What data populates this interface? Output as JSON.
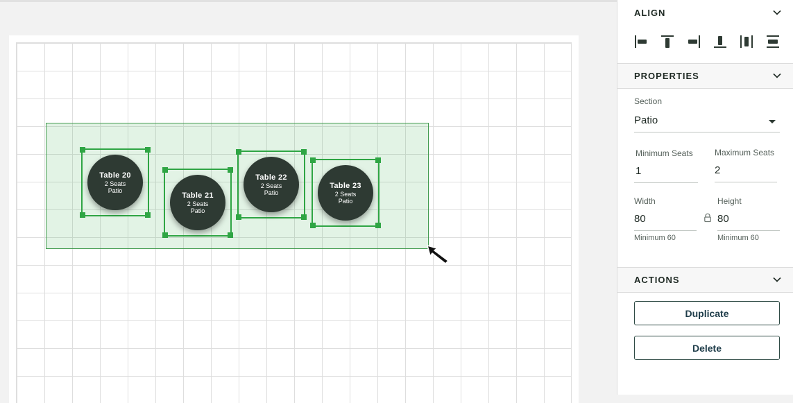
{
  "canvas": {
    "tables": [
      {
        "name": "Table 20",
        "seats": "2 Seats",
        "section": "Patio"
      },
      {
        "name": "Table 21",
        "seats": "2 Seats",
        "section": "Patio"
      },
      {
        "name": "Table 22",
        "seats": "2 Seats",
        "section": "Patio"
      },
      {
        "name": "Table 23",
        "seats": "2 Seats",
        "section": "Patio"
      }
    ]
  },
  "panel": {
    "align": {
      "title": "ALIGN",
      "tools": [
        "align-left-icon",
        "align-top-icon",
        "align-right-icon",
        "align-bottom-icon",
        "distribute-horizontal-icon",
        "distribute-vertical-icon"
      ]
    },
    "properties": {
      "title": "PROPERTIES",
      "section_label": "Section",
      "section_value": "Patio",
      "min_seats_label": "Minimum Seats",
      "min_seats_value": "1",
      "max_seats_label": "Maximum Seats",
      "max_seats_value": "2",
      "width_label": "Width",
      "width_value": "80",
      "width_hint": "Minimum 60",
      "height_label": "Height",
      "height_value": "80",
      "height_hint": "Minimum 60"
    },
    "actions": {
      "title": "ACTIONS",
      "duplicate_label": "Duplicate",
      "delete_label": "Delete"
    }
  },
  "colors": {
    "selection": "#2fa544",
    "table_fill": "#2e3a33",
    "marquee_fill": "#3daf50"
  }
}
